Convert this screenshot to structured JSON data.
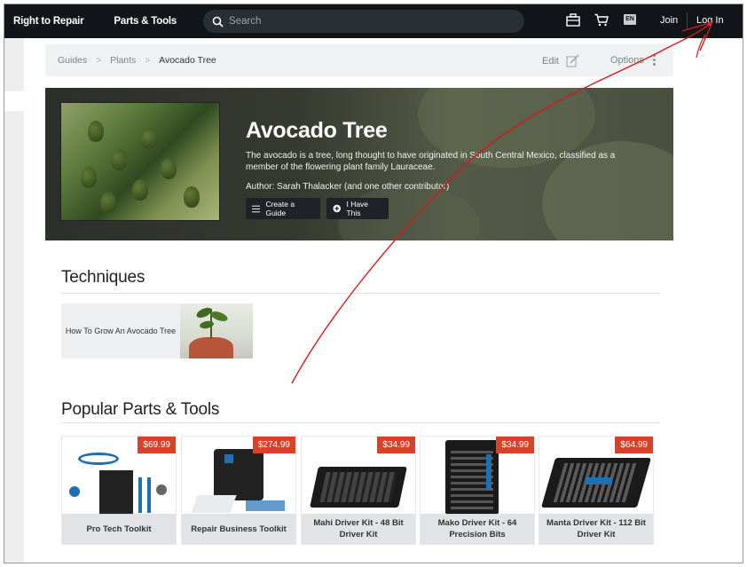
{
  "topnav": {
    "brand": "Right to Repair",
    "parts_tools": "Parts & Tools",
    "search_placeholder": "Search",
    "lang": "EN",
    "join": "Join",
    "login": "Log In"
  },
  "breadcrumb": {
    "items": [
      "Guides",
      "Plants",
      "Avocado Tree"
    ],
    "edit": "Edit",
    "options": "Options"
  },
  "hero": {
    "title": "Avocado Tree",
    "description": "The avocado is a tree, long thought to have originated in South Central Mexico, classified as a member of the flowering plant family Lauraceae.",
    "author": "Author: Sarah Thalacker (and one other contributor)",
    "create_guide": "Create a Guide",
    "i_have_this": "I Have This"
  },
  "techniques": {
    "title": "Techniques",
    "card_label": "How To Grow An Avocado Tree"
  },
  "parts": {
    "title": "Popular Parts & Tools",
    "products": [
      {
        "price": "$69.99",
        "name": "Pro Tech Toolkit"
      },
      {
        "price": "$274.99",
        "name": "Repair Business Toolkit"
      },
      {
        "price": "$34.99",
        "name": "Mahi Driver Kit - 48 Bit Driver Kit"
      },
      {
        "price": "$34.99",
        "name": "Mako Driver Kit - 64 Precision Bits"
      },
      {
        "price": "$64.99",
        "name": "Manta Driver Kit - 112 Bit Driver Kit"
      }
    ]
  },
  "colors": {
    "nav_bg": "#111418",
    "price_badge": "#d9422a",
    "annotation_red": "#d21b1b"
  }
}
